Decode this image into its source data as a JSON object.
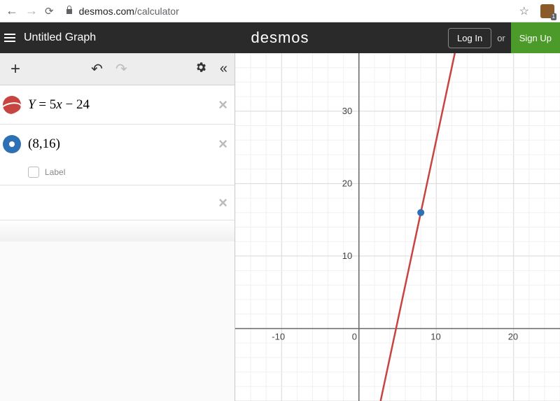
{
  "browser": {
    "url_domain": "desmos.com",
    "url_path": "/calculator"
  },
  "header": {
    "title": "Untitled Graph",
    "logo": "desmos",
    "login": "Log In",
    "or": "or",
    "signup": "Sign Up"
  },
  "expressions": [
    {
      "type": "line",
      "display": "Y = 5x − 24"
    },
    {
      "type": "point",
      "display": "(8,16)",
      "label_option": "Label"
    }
  ],
  "chart_data": {
    "type": "line",
    "title": "",
    "xlabel": "",
    "ylabel": "",
    "x_ticks": [
      -10,
      0,
      10,
      20
    ],
    "y_ticks": [
      10,
      20,
      30
    ],
    "xlim": [
      -16,
      26
    ],
    "ylim": [
      -10,
      38
    ],
    "series": [
      {
        "name": "Y = 5x - 24",
        "equation": "y = 5*x - 24",
        "color": "#c74440"
      }
    ],
    "points": [
      {
        "name": "(8,16)",
        "x": 8,
        "y": 16,
        "color": "#2d70b3"
      }
    ]
  }
}
